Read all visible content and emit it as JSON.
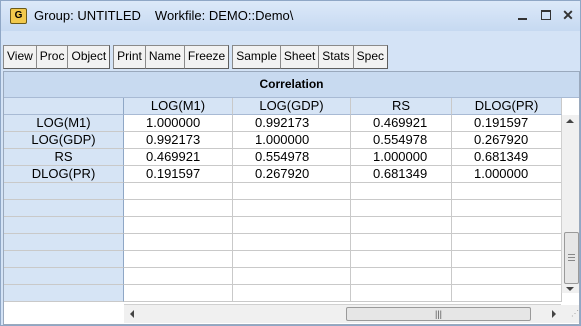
{
  "window": {
    "icon_letter": "G",
    "title": "Group: UNTITLED",
    "workfile": "Workfile: DEMO::Demo\\"
  },
  "toolbar": {
    "view": "View",
    "proc": "Proc",
    "object": "Object",
    "print": "Print",
    "name": "Name",
    "freeze": "Freeze",
    "sample": "Sample",
    "sheet": "Sheet",
    "stats": "Stats",
    "spec": "Spec"
  },
  "table": {
    "title": "Correlation",
    "columns": [
      "LOG(M1)",
      "LOG(GDP)",
      "RS",
      "DLOG(PR)"
    ],
    "rows": [
      {
        "label": "LOG(M1)",
        "values": [
          "1.000000",
          "0.992173",
          "0.469921",
          "0.191597"
        ]
      },
      {
        "label": "LOG(GDP)",
        "values": [
          "0.992173",
          "1.000000",
          "0.554978",
          "0.267920"
        ]
      },
      {
        "label": "RS",
        "values": [
          "0.469921",
          "0.554978",
          "1.000000",
          "0.681349"
        ]
      },
      {
        "label": "DLOG(PR)",
        "values": [
          "0.191597",
          "0.267920",
          "0.681349",
          "1.000000"
        ]
      }
    ]
  },
  "icons": {
    "app": "group-object-icon",
    "minimize": "minimize-icon",
    "maximize": "maximize-icon",
    "close": "close-icon"
  }
}
